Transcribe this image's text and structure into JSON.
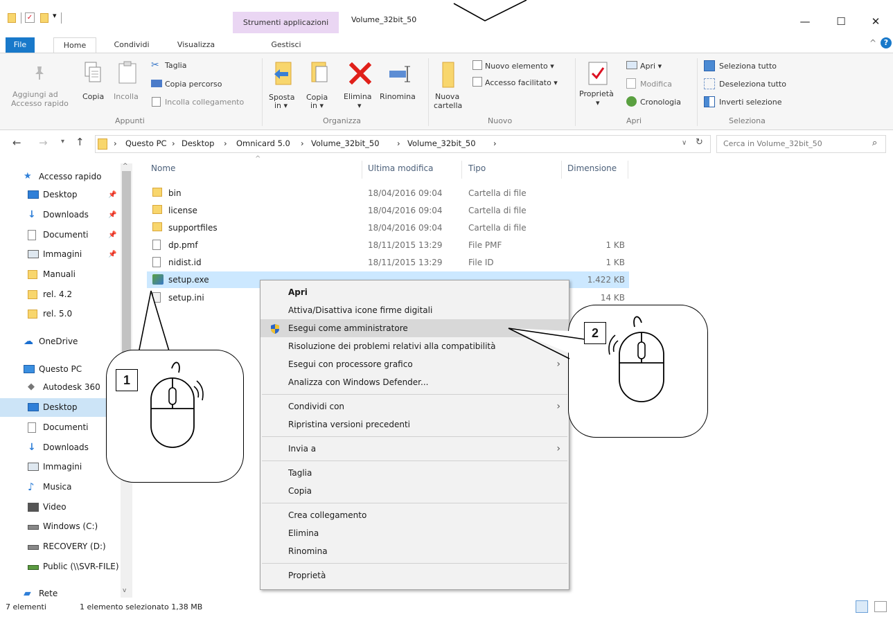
{
  "window": {
    "title": "Volume_32bit_50",
    "context_tab": "Strumenti applicazioni",
    "controls": {
      "minimize": "—",
      "maximize": "☐",
      "close": "✕"
    }
  },
  "ribbon": {
    "tabs": [
      "File",
      "Home",
      "Condividi",
      "Visualizza",
      "Gestisci"
    ],
    "pin_label_1": "Aggiungi ad",
    "pin_label_2": "Accesso rapido",
    "copy": "Copia",
    "paste": "Incolla",
    "cut": "Taglia",
    "copy_path": "Copia percorso",
    "paste_link": "Incolla collegamento",
    "group_clipboard": "Appunti",
    "move_1": "Sposta",
    "move_2": "in ▾",
    "copyto_1": "Copia",
    "copyto_2": "in ▾",
    "delete": "Elimina",
    "delete_arrow": "▾",
    "rename": "Rinomina",
    "group_organize": "Organizza",
    "new_folder_1": "Nuova",
    "new_folder_2": "cartella",
    "new_item": "Nuovo elemento ▾",
    "easy_access": "Accesso facilitato ▾",
    "group_new": "Nuovo",
    "properties": "Proprietà",
    "properties_arrow": "▾",
    "open": "Apri ▾",
    "edit": "Modifica",
    "history": "Cronologia",
    "group_open": "Apri",
    "select_all": "Seleziona tutto",
    "select_none": "Deseleziona tutto",
    "invert": "Inverti selezione",
    "group_select": "Seleziona",
    "collapse": "^",
    "help": "?"
  },
  "address": {
    "crumbs": [
      "Questo PC",
      "Desktop",
      "Omnicard 5.0",
      "Volume_32bit_50",
      "Volume_32bit_50"
    ],
    "search_placeholder": "Cerca in Volume_32bit_50"
  },
  "nav": [
    {
      "label": "Accesso rapido",
      "icon": "star-icon",
      "pinned": false,
      "selected": false
    },
    {
      "label": "Desktop",
      "icon": "desktop-icon",
      "pinned": true,
      "selected": false
    },
    {
      "label": "Downloads",
      "icon": "download-icon",
      "pinned": true,
      "selected": false
    },
    {
      "label": "Documenti",
      "icon": "document-icon",
      "pinned": true,
      "selected": false
    },
    {
      "label": "Immagini",
      "icon": "pictures-icon",
      "pinned": true,
      "selected": false
    },
    {
      "label": "Manuali",
      "icon": "folder-icon",
      "pinned": false,
      "selected": false
    },
    {
      "label": "rel. 4.2",
      "icon": "folder-icon",
      "pinned": false,
      "selected": false
    },
    {
      "label": "rel. 5.0",
      "icon": "folder-icon",
      "pinned": false,
      "selected": false
    },
    {
      "label": "OneDrive",
      "icon": "cloud-icon",
      "pinned": false,
      "selected": false
    },
    {
      "label": "Questo PC",
      "icon": "computer-icon",
      "pinned": false,
      "selected": false
    },
    {
      "label": "Autodesk 360",
      "icon": "autodesk-icon",
      "pinned": false,
      "selected": false
    },
    {
      "label": "Desktop",
      "icon": "desktop-icon",
      "pinned": false,
      "selected": true
    },
    {
      "label": "Documenti",
      "icon": "document-icon",
      "pinned": false,
      "selected": false
    },
    {
      "label": "Downloads",
      "icon": "download-icon",
      "pinned": false,
      "selected": false
    },
    {
      "label": "Immagini",
      "icon": "pictures-icon",
      "pinned": false,
      "selected": false
    },
    {
      "label": "Musica",
      "icon": "music-icon",
      "pinned": false,
      "selected": false
    },
    {
      "label": "Video",
      "icon": "video-icon",
      "pinned": false,
      "selected": false
    },
    {
      "label": "Windows (C:)",
      "icon": "drive-icon",
      "pinned": false,
      "selected": false
    },
    {
      "label": "RECOVERY (D:)",
      "icon": "drive-icon",
      "pinned": false,
      "selected": false
    },
    {
      "label": "Public (\\\\SVR-FILE)",
      "icon": "network-drive-icon",
      "pinned": false,
      "selected": false
    },
    {
      "label": "Rete",
      "icon": "network-icon",
      "pinned": false,
      "selected": false
    }
  ],
  "list": {
    "columns": [
      "Nome",
      "Ultima modifica",
      "Tipo",
      "Dimensione"
    ],
    "rows": [
      {
        "name": "bin",
        "date": "18/04/2016 09:04",
        "type": "Cartella di file",
        "size": "",
        "icon": "folder-icon",
        "selected": false
      },
      {
        "name": "license",
        "date": "18/04/2016 09:04",
        "type": "Cartella di file",
        "size": "",
        "icon": "folder-icon",
        "selected": false
      },
      {
        "name": "supportfiles",
        "date": "18/04/2016 09:04",
        "type": "Cartella di file",
        "size": "",
        "icon": "folder-icon",
        "selected": false
      },
      {
        "name": "dp.pmf",
        "date": "18/11/2015 13:29",
        "type": "File PMF",
        "size": "1 KB",
        "icon": "file-icon",
        "selected": false
      },
      {
        "name": "nidist.id",
        "date": "18/11/2015 13:29",
        "type": "File ID",
        "size": "1 KB",
        "icon": "file-icon",
        "selected": false
      },
      {
        "name": "setup.exe",
        "date": "",
        "type": "",
        "size": "1.422 KB",
        "icon": "setup-exe-icon",
        "selected": true
      },
      {
        "name": "setup.ini",
        "date": "",
        "type": "",
        "size": "14 KB",
        "icon": "ini-file-icon",
        "selected": false
      }
    ]
  },
  "context_menu": [
    {
      "label": "Apri",
      "bold": true
    },
    {
      "label": "Attiva/Disattiva icone firme digitali"
    },
    {
      "label": "Esegui come amministratore",
      "shield": true,
      "hover": true
    },
    {
      "label": "Risoluzione dei problemi relativi alla compatibilità"
    },
    {
      "label": "Esegui con processore grafico",
      "submenu": true
    },
    {
      "label": "Analizza con Windows Defender..."
    },
    {
      "separator": true
    },
    {
      "label": "Condividi con",
      "submenu": true
    },
    {
      "label": "Ripristina versioni precedenti"
    },
    {
      "separator": true
    },
    {
      "label": "Invia a",
      "submenu": true
    },
    {
      "separator": true
    },
    {
      "label": "Taglia"
    },
    {
      "label": "Copia"
    },
    {
      "separator": true
    },
    {
      "label": "Crea collegamento"
    },
    {
      "label": "Elimina"
    },
    {
      "label": "Rinomina"
    },
    {
      "separator": true
    },
    {
      "label": "Proprietà"
    }
  ],
  "status": {
    "count": "7 elementi",
    "selection": "1 elemento selezionato  1,38 MB"
  },
  "callouts": {
    "first": "1",
    "second": "2"
  },
  "colors": {
    "accent": "#1979ca",
    "selection": "#cce8ff",
    "context_tab": "#ead6f3",
    "folder": "#f8d66d"
  }
}
